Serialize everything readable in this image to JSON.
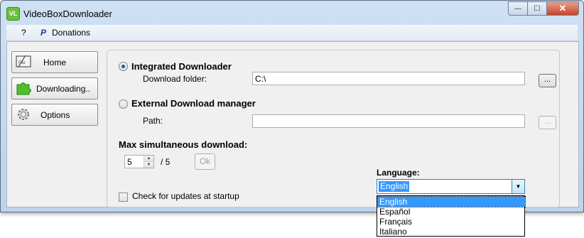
{
  "window": {
    "title": "VideoBoxDownloader",
    "app_icon_text": "VL"
  },
  "window_buttons": {
    "minimize": "—",
    "maximize": "☐",
    "close": "✕"
  },
  "menu": {
    "help_label": "?",
    "donations_label": "Donations"
  },
  "sidebar": {
    "items": [
      {
        "label": "Home"
      },
      {
        "label": "Downloading.."
      },
      {
        "label": "Options"
      }
    ]
  },
  "settings": {
    "integrated_label": "Integrated Downloader",
    "download_folder_label": "Download folder:",
    "download_folder_value": "C:\\",
    "browse_label": "...",
    "external_label": "External Download manager",
    "path_label": "Path:",
    "path_value": "",
    "browse_path_label": "...",
    "max_label": "Max simultaneous download:",
    "max_value": "5",
    "max_total": "/ 5",
    "ok_label": "Ok",
    "updates_label": "Check for updates at startup",
    "updates_checked": false,
    "selected_mode": "integrated"
  },
  "language": {
    "label": "Language:",
    "selected": "English",
    "options": [
      "English",
      "Español",
      "Français",
      "Italiano"
    ],
    "highlighted": "English"
  }
}
